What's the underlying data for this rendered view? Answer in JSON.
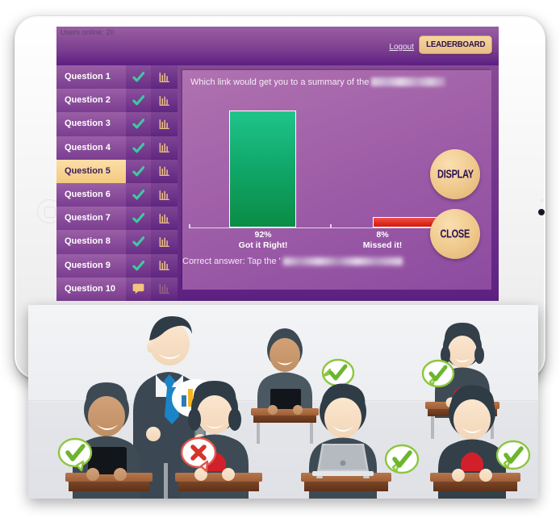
{
  "app": {
    "users_online": "Users online: 20",
    "logout_label": "Logout",
    "leaderboard_label": "LEADERBOARD"
  },
  "questions": [
    {
      "label": "Question 1",
      "status_icon": "check-icon",
      "chart_icon": "bar-chart-icon",
      "active": false,
      "chart_enabled": true
    },
    {
      "label": "Question 2",
      "status_icon": "check-icon",
      "chart_icon": "bar-chart-icon",
      "active": false,
      "chart_enabled": true
    },
    {
      "label": "Question 3",
      "status_icon": "check-icon",
      "chart_icon": "bar-chart-icon",
      "active": false,
      "chart_enabled": true
    },
    {
      "label": "Question 4",
      "status_icon": "check-icon",
      "chart_icon": "bar-chart-icon",
      "active": false,
      "chart_enabled": true
    },
    {
      "label": "Question 5",
      "status_icon": "check-icon",
      "chart_icon": "bar-chart-icon",
      "active": true,
      "chart_enabled": true
    },
    {
      "label": "Question 6",
      "status_icon": "check-icon",
      "chart_icon": "bar-chart-icon",
      "active": false,
      "chart_enabled": true
    },
    {
      "label": "Question 7",
      "status_icon": "check-icon",
      "chart_icon": "bar-chart-icon",
      "active": false,
      "chart_enabled": true
    },
    {
      "label": "Question 8",
      "status_icon": "check-icon",
      "chart_icon": "bar-chart-icon",
      "active": false,
      "chart_enabled": true
    },
    {
      "label": "Question 9",
      "status_icon": "check-icon",
      "chart_icon": "bar-chart-icon",
      "active": false,
      "chart_enabled": true
    },
    {
      "label": "Question 10",
      "status_icon": "speech-bubble-icon",
      "chart_icon": "bar-chart-icon",
      "active": false,
      "chart_enabled": false
    }
  ],
  "result": {
    "question_prefix": "Which link would get you to a summary of the",
    "question_redacted": true,
    "correct_answer_prefix": "Correct answer: Tap the '",
    "correct_answer_redacted": true,
    "display_button": "DISPLAY",
    "close_button": "CLOSE"
  },
  "chart_data": {
    "type": "bar",
    "categories": [
      "Got it Right!",
      "Missed it!"
    ],
    "values": [
      92,
      8
    ],
    "value_labels": [
      "92%",
      "8%"
    ],
    "colors": [
      "#11a96c",
      "#e12e22"
    ],
    "title": "",
    "xlabel": "",
    "ylabel": "",
    "ylim": [
      0,
      100
    ],
    "grid": false,
    "legend": "none"
  },
  "colors": {
    "brand_purple": "#6a2e86",
    "panel_purple": "#a05fa8",
    "accent_tan": "#efc88c",
    "correct_green": "#11a96c",
    "missed_red": "#e12e22"
  },
  "classroom": {
    "alt": "classroom-illustration",
    "teacher_bubble_icon": "bar-chart-icon",
    "student_markers": [
      {
        "icon": "check-icon"
      },
      {
        "icon": "cross-icon"
      },
      {
        "icon": "check-icon"
      },
      {
        "icon": "check-icon"
      },
      {
        "icon": "check-icon"
      },
      {
        "icon": "check-icon"
      }
    ]
  }
}
